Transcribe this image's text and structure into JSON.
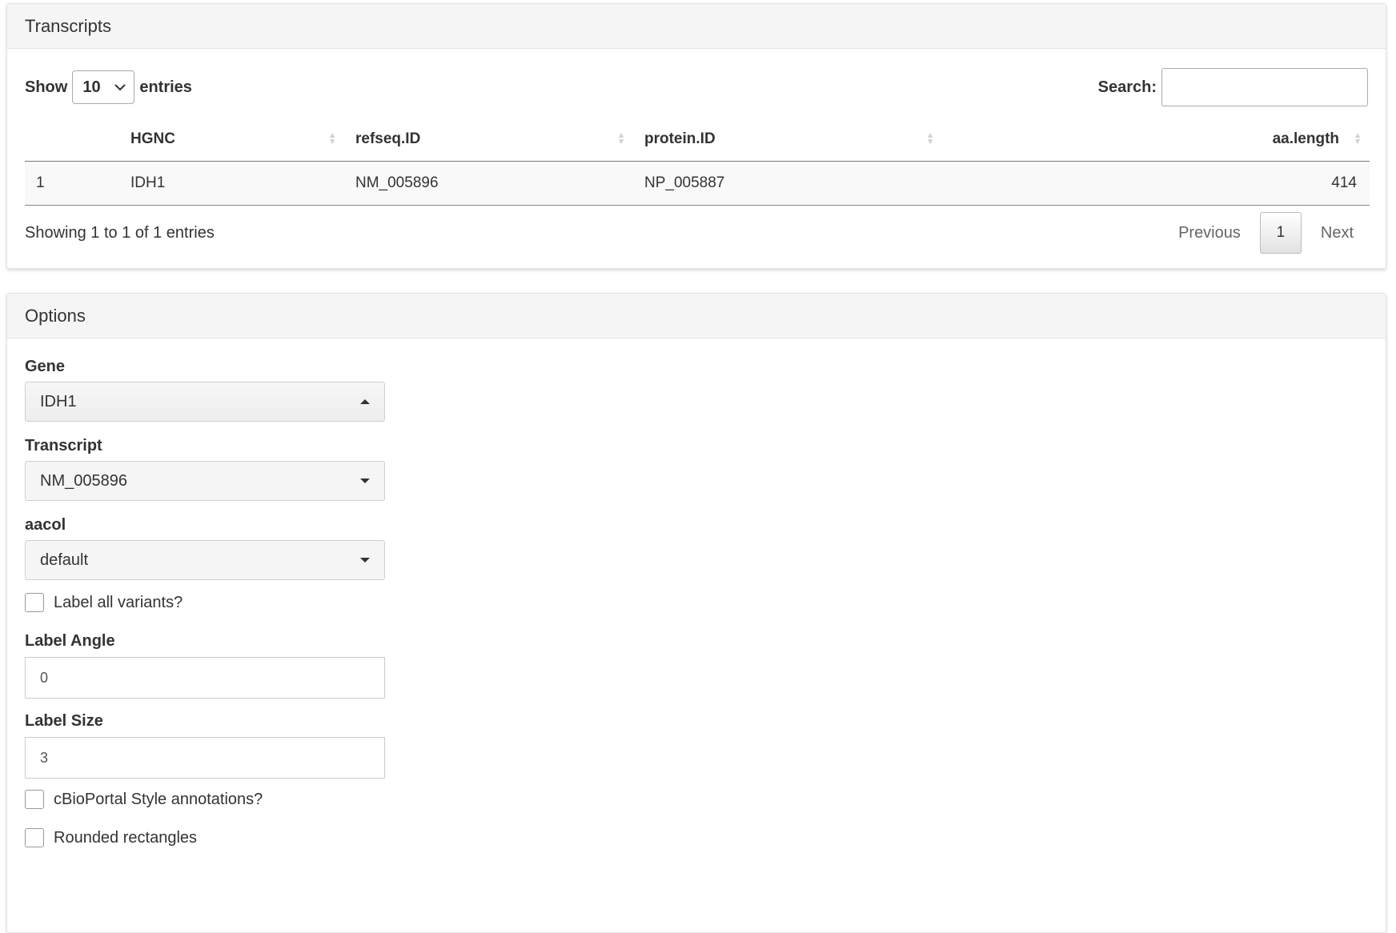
{
  "transcripts": {
    "title": "Transcripts",
    "show_label": "Show",
    "entries_label": "entries",
    "page_length": "10",
    "search_label": "Search:",
    "search_value": "",
    "columns": [
      "",
      "HGNC",
      "refseq.ID",
      "protein.ID",
      "aa.length"
    ],
    "rows": [
      {
        "index": "1",
        "hgnc": "IDH1",
        "refseq": "NM_005896",
        "protein": "NP_005887",
        "aa_length": "414"
      }
    ],
    "info": "Showing 1 to 1 of 1 entries",
    "pagination": {
      "previous": "Previous",
      "current": "1",
      "next": "Next"
    }
  },
  "options": {
    "title": "Options",
    "gene": {
      "label": "Gene",
      "value": "IDH1"
    },
    "transcript": {
      "label": "Transcript",
      "value": "NM_005896"
    },
    "aacol": {
      "label": "aacol",
      "value": "default"
    },
    "label_all_variants": {
      "label": "Label all variants?",
      "checked": false
    },
    "label_angle": {
      "label": "Label Angle",
      "value": "0"
    },
    "label_size": {
      "label": "Label Size",
      "value": "3"
    },
    "cbioportal_style": {
      "label": "cBioPortal Style annotations?",
      "checked": false
    },
    "rounded_rectangles": {
      "label": "Rounded rectangles",
      "checked": false
    }
  }
}
